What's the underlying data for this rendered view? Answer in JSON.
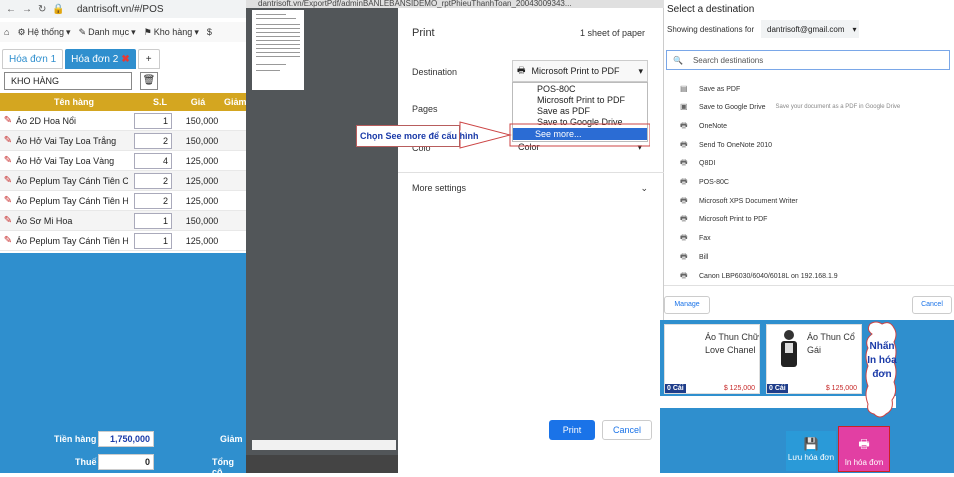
{
  "browser": {
    "url": "dantrisoft.vn/#/POS",
    "preview_url": "dantrisoft.vn/ExportPdf/adminBANLEBANSIDEMO_rptPhieuThanhToan_20043009343..."
  },
  "pos_menu": {
    "items": [
      {
        "label": "He thong"
      },
      {
        "label": "Danh muc"
      },
      {
        "label": "Kho hang"
      },
      {
        "label": "$"
      }
    ],
    "home_icon": "home-icon"
  },
  "pos_menu_vi": [
    "Hệ thống",
    "Danh mục",
    "Kho hàng",
    "$"
  ],
  "tabs": [
    {
      "label": "Hóa đơn 1"
    },
    {
      "label": "Hóa đơn 2"
    },
    {
      "label": "+"
    }
  ],
  "warehouse": "KHO HÀNG",
  "table": {
    "headers": [
      "Tên hàng",
      "S.L",
      "Giá",
      "Giảm"
    ],
    "rows": [
      {
        "name": "Áo 2D Hoa Nổi",
        "qty": "1",
        "price": "150,000"
      },
      {
        "name": "Áo Hở Vai Tay Loa Trắng",
        "qty": "2",
        "price": "150,000"
      },
      {
        "name": "Áo Hở Vai Tay Loa Vàng",
        "qty": "4",
        "price": "125,000"
      },
      {
        "name": "Áo Peplum Tay Cánh Tiên C...",
        "qty": "2",
        "price": "125,000"
      },
      {
        "name": "Áo Peplum Tay Cánh Tiên H...",
        "qty": "2",
        "price": "125,000"
      },
      {
        "name": "Áo Sơ Mi Hoa",
        "qty": "1",
        "price": "150,000"
      },
      {
        "name": "Áo Peplum Tay Cánh Tiên H...",
        "qty": "1",
        "price": "125,000"
      }
    ]
  },
  "footer": {
    "subtotal_label": "Tiền hàng",
    "subtotal": "1,750,000",
    "tax_label": "Thuế",
    "tax": "0",
    "discount_label": "Giảm",
    "total_label": "Tổng cộ"
  },
  "print": {
    "title": "Print",
    "sheet_count": "1 sheet of paper",
    "destination_label": "Destination",
    "destination_value": "Microsoft Print to PDF",
    "pages_label": "Pages",
    "color_label": "Colo",
    "color_value": "Color",
    "more_settings": "More settings",
    "dropdown_options": [
      "POS-80C",
      "Microsoft Print to PDF",
      "Save as PDF",
      "Save to Google Drive",
      "See more..."
    ],
    "print_button": "Print",
    "cancel_button": "Cancel"
  },
  "annotation": {
    "callout": "Chọn See more để cấu hình",
    "cloud": "Nhấn In hóa đơn"
  },
  "destinations": {
    "title": "Select a destination",
    "showing_label": "Showing destinations for",
    "account": "dantrisoft@gmail.com",
    "search_placeholder": "Search destinations",
    "items": [
      {
        "label": "Save as PDF",
        "sub": ""
      },
      {
        "label": "Save to Google Drive",
        "sub": "Save your document as a PDF in Google Drive"
      },
      {
        "label": "OneNote",
        "sub": ""
      },
      {
        "label": "Send To OneNote 2010",
        "sub": ""
      },
      {
        "label": "Q8DI",
        "sub": ""
      },
      {
        "label": "POS-80C",
        "sub": ""
      },
      {
        "label": "Microsoft XPS Document Writer",
        "sub": ""
      },
      {
        "label": "Microsoft Print to PDF",
        "sub": ""
      },
      {
        "label": "Fax",
        "sub": ""
      },
      {
        "label": "Bill",
        "sub": ""
      },
      {
        "label": "Canon LBP6030/6040/6018L on 192.168.1.9",
        "sub": ""
      }
    ],
    "manage_button": "Manage",
    "cancel_button": "Cancel"
  },
  "products": [
    {
      "name": "Áo Thun Chữ Love Chanel",
      "qty": "0 Cái",
      "price": "$ 125,000"
    },
    {
      "name": "Áo Thun Cổ Gái",
      "qty": "0 Cái",
      "price": "$ 125,000"
    }
  ],
  "actions": {
    "save_bill": "Lưu hóa đơn",
    "print_bill": "In hóa đơn"
  },
  "colors": {
    "pos_blue": "#2f8fce",
    "header_gold": "#d4a620",
    "print_blue": "#1a73e8",
    "print_bill_pink": "#e23fa3"
  }
}
